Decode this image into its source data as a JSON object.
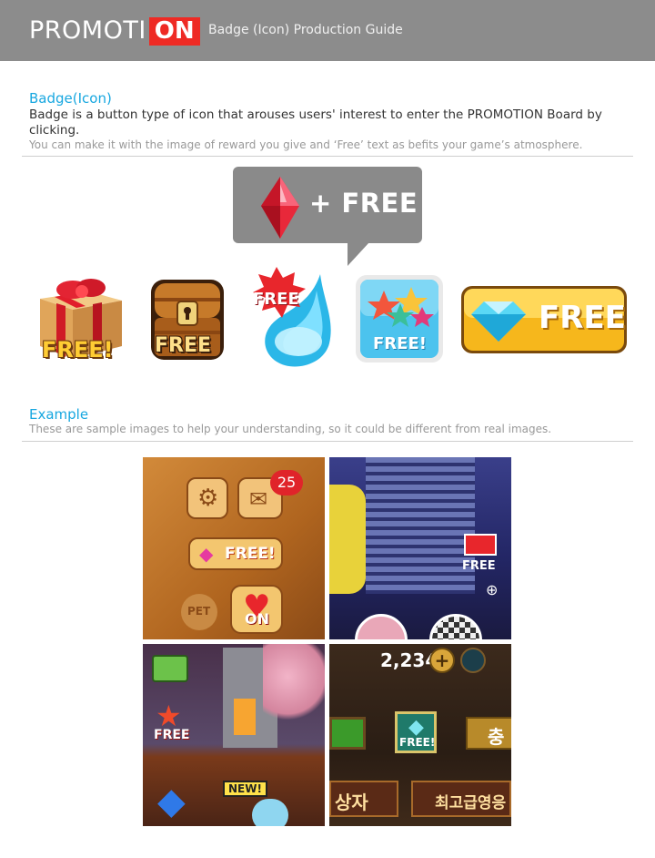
{
  "header": {
    "logo_main": "PROMOTI",
    "logo_on": "ON",
    "subtitle": "Badge (Icon) Production Guide"
  },
  "badge_section": {
    "title": "Badge(Icon)",
    "description": "Badge is a button type of icon that arouses users' interest to enter the PROMOTION Board by clicking.",
    "note": "You can make it with the image of reward you give and ‘Free’ text as befits your game’s atmosphere."
  },
  "bubble": {
    "text": "+ FREE"
  },
  "badges": [
    {
      "icon": "gift-box-icon",
      "label": "FREE!"
    },
    {
      "icon": "treasure-chest-icon",
      "label": "FREE"
    },
    {
      "icon": "gem-drop-icon",
      "label": "FREE"
    },
    {
      "icon": "stars-icon",
      "label": "FREE!"
    },
    {
      "icon": "diamond-icon",
      "label": "FREE"
    }
  ],
  "example_section": {
    "title": "Example",
    "note": "These are sample images to help your understanding, so it could be different from real images."
  },
  "examples": {
    "tile1": {
      "badge": "25",
      "label": "FREE!",
      "pet": "PET",
      "on": "ON"
    },
    "tile2": {
      "label": "FREE"
    },
    "tile3": {
      "label": "FREE",
      "new": "NEW!"
    },
    "tile4": {
      "count": "2,234",
      "label": "FREE!",
      "text_left": "상자",
      "text_right": "최고급영응",
      "text_top_right": "충"
    }
  },
  "colors": {
    "header_bg": "#8c8c8c",
    "logo_on_bg": "#ee2a24",
    "accent_blue": "#17a7e0"
  }
}
